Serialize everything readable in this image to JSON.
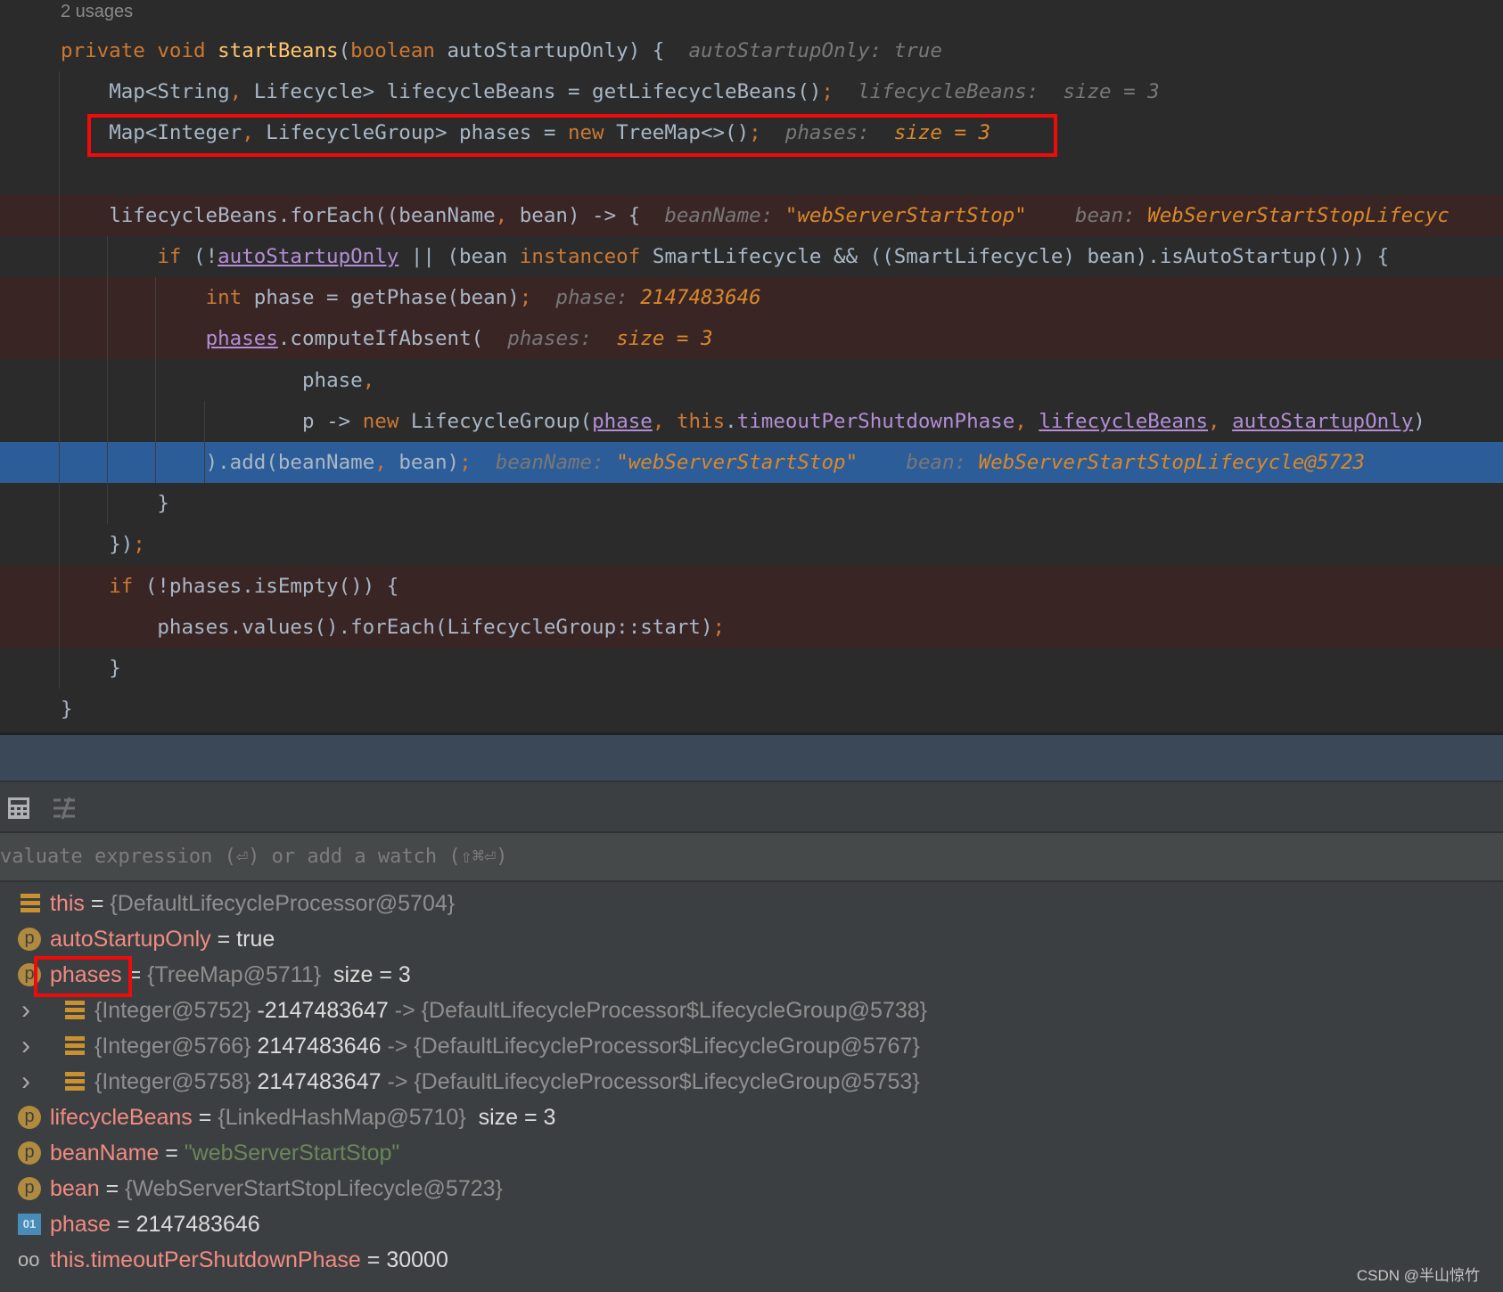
{
  "editor": {
    "usages": "2 usages",
    "lines": [
      {
        "indent": 0,
        "bg": "",
        "tokens": [
          [
            "k",
            "private void "
          ],
          [
            "f",
            "startBeans"
          ],
          [
            "t",
            "("
          ],
          [
            "k",
            "boolean "
          ],
          [
            "t",
            "autoStartupOnly) {  "
          ],
          [
            "h",
            "autoStartupOnly: true"
          ]
        ]
      },
      {
        "indent": 1,
        "bg": "",
        "tokens": [
          [
            "t",
            "Map<String"
          ],
          [
            "k",
            ", "
          ],
          [
            "t",
            "Lifecycle> lifecycleBeans = getLifecycleBeans()"
          ],
          [
            "k",
            ";"
          ],
          [
            "h",
            "  lifecycleBeans:  size = 3"
          ]
        ]
      },
      {
        "indent": 1,
        "bg": "",
        "tokens": [
          [
            "t",
            "Map<Integer"
          ],
          [
            "k",
            ", "
          ],
          [
            "t",
            "LifecycleGroup> phases = "
          ],
          [
            "k",
            "new "
          ],
          [
            "t",
            "TreeMap<>()"
          ],
          [
            "k",
            ";"
          ],
          [
            "h",
            "  phases:  "
          ],
          [
            "hv",
            "size = 3"
          ]
        ]
      },
      {
        "indent": 1,
        "bg": "",
        "tokens": []
      },
      {
        "indent": 1,
        "bg": "red",
        "tokens": [
          [
            "t",
            "lifecycleBeans.forEach((beanName"
          ],
          [
            "k",
            ", "
          ],
          [
            "t",
            "bean) -> {  "
          ],
          [
            "h",
            "beanName: "
          ],
          [
            "hv",
            "\"webServerStartStop\""
          ],
          [
            "h",
            "    bean: "
          ],
          [
            "hv",
            "WebServerStartStopLifecyc"
          ]
        ]
      },
      {
        "indent": 2,
        "bg": "",
        "tokens": [
          [
            "k",
            "if "
          ],
          [
            "t",
            "(!"
          ],
          [
            "p",
            "autoStartupOnly"
          ],
          [
            "t",
            " || (bean "
          ],
          [
            "k",
            "instanceof "
          ],
          [
            "t",
            "SmartLifecycle && ((SmartLifecycle) bean).isAutoStartup())) {"
          ]
        ]
      },
      {
        "indent": 3,
        "bg": "red",
        "tokens": [
          [
            "k",
            "int "
          ],
          [
            "t",
            "phase = getPhase(bean)"
          ],
          [
            "k",
            ";"
          ],
          [
            "h",
            "  phase: "
          ],
          [
            "hv",
            "2147483646"
          ]
        ]
      },
      {
        "indent": 3,
        "bg": "red",
        "tokens": [
          [
            "p",
            "phases"
          ],
          [
            "t",
            ".computeIfAbsent("
          ],
          [
            "h",
            "  phases:  "
          ],
          [
            "hv",
            "size = 3"
          ]
        ]
      },
      {
        "indent": 5,
        "bg": "",
        "tokens": [
          [
            "t",
            "phase"
          ],
          [
            "k",
            ","
          ]
        ]
      },
      {
        "indent": 5,
        "bg": "",
        "tokens": [
          [
            "t",
            "p -> "
          ],
          [
            "k",
            "new "
          ],
          [
            "t",
            "LifecycleGroup("
          ],
          [
            "p",
            "phase"
          ],
          [
            "k",
            ", this"
          ],
          [
            "t",
            "."
          ],
          [
            "pf",
            "timeoutPerShutdownPhase"
          ],
          [
            "k",
            ", "
          ],
          [
            "p",
            "lifecycleBeans"
          ],
          [
            "k",
            ", "
          ],
          [
            "p",
            "autoStartupOnly"
          ],
          [
            "t",
            ")"
          ]
        ]
      },
      {
        "indent": 3,
        "bg": "blue",
        "tokens": [
          [
            "t",
            ").add(beanName"
          ],
          [
            "k",
            ", "
          ],
          [
            "t",
            "bean)"
          ],
          [
            "k",
            ";"
          ],
          [
            "h",
            "  beanName: "
          ],
          [
            "hv",
            "\"webServerStartStop\""
          ],
          [
            "h",
            "    bean: "
          ],
          [
            "hv",
            "WebServerStartStopLifecycle@5723"
          ]
        ]
      },
      {
        "indent": 2,
        "bg": "",
        "tokens": [
          [
            "t",
            "}"
          ]
        ]
      },
      {
        "indent": 1,
        "bg": "",
        "tokens": [
          [
            "t",
            "})"
          ],
          [
            "k",
            ";"
          ]
        ]
      },
      {
        "indent": 1,
        "bg": "red",
        "tokens": [
          [
            "k",
            "if "
          ],
          [
            "t",
            "(!phases.isEmpty()) {"
          ]
        ]
      },
      {
        "indent": 2,
        "bg": "red",
        "tokens": [
          [
            "t",
            "phases.values().forEach(LifecycleGroup::start)"
          ],
          [
            "k",
            ";"
          ]
        ]
      },
      {
        "indent": 1,
        "bg": "",
        "tokens": [
          [
            "t",
            "}"
          ]
        ]
      },
      {
        "indent": 0,
        "bg": "",
        "tokens": [
          [
            "t",
            "}"
          ]
        ]
      }
    ]
  },
  "debugger": {
    "toolbar_icons": [
      "calculator-icon",
      "restore-layout-icon"
    ],
    "eval_placeholder": "valuate expression (⏎) or add a watch (⇧⌘⏎)",
    "variables": [
      {
        "icon": "field",
        "level": 0,
        "expand": false,
        "name": "this",
        "eq": " = ",
        "val": "{DefaultLifecycleProcessor@5704}",
        "extra": ""
      },
      {
        "icon": "p",
        "level": 0,
        "expand": false,
        "name": "autoStartupOnly",
        "eq": " = ",
        "lit": "true"
      },
      {
        "icon": "p",
        "level": 0,
        "expand": false,
        "name": "phases",
        "eq": " = ",
        "val": "{TreeMap@5711}",
        "extra": "  size = 3"
      },
      {
        "icon": "field",
        "level": 1,
        "expand": true,
        "val": "{Integer@5752}",
        "lit": " -2147483647",
        "val2": " -> {DefaultLifecycleProcessor$LifecycleGroup@5738}"
      },
      {
        "icon": "field",
        "level": 1,
        "expand": true,
        "val": "{Integer@5766}",
        "lit": " 2147483646",
        "val2": " -> {DefaultLifecycleProcessor$LifecycleGroup@5767}"
      },
      {
        "icon": "field",
        "level": 1,
        "expand": true,
        "val": "{Integer@5758}",
        "lit": " 2147483647",
        "val2": " -> {DefaultLifecycleProcessor$LifecycleGroup@5753}"
      },
      {
        "icon": "p",
        "level": 0,
        "expand": false,
        "name": "lifecycleBeans",
        "eq": " = ",
        "val": "{LinkedHashMap@5710}",
        "extra": "  size = 3"
      },
      {
        "icon": "p",
        "level": 0,
        "expand": false,
        "name": "beanName",
        "eq": " = ",
        "str": "\"webServerStartStop\""
      },
      {
        "icon": "p",
        "level": 0,
        "expand": false,
        "name": "bean",
        "eq": " = ",
        "val": "{WebServerStartStopLifecycle@5723}"
      },
      {
        "icon": "01",
        "level": 0,
        "expand": false,
        "name": "phase",
        "eq": " = ",
        "lit": "2147483646"
      },
      {
        "icon": "watch",
        "level": 0,
        "expand": false,
        "name": "this.timeoutPerShutdownPhase",
        "eq": " = ",
        "lit": "30000"
      }
    ]
  },
  "watermark": "CSDN @半山惊竹",
  "colors": {
    "highlight_box": "#f00a0a",
    "current_line": "#2d5d98",
    "breakpoint_line": "#3a2525"
  }
}
